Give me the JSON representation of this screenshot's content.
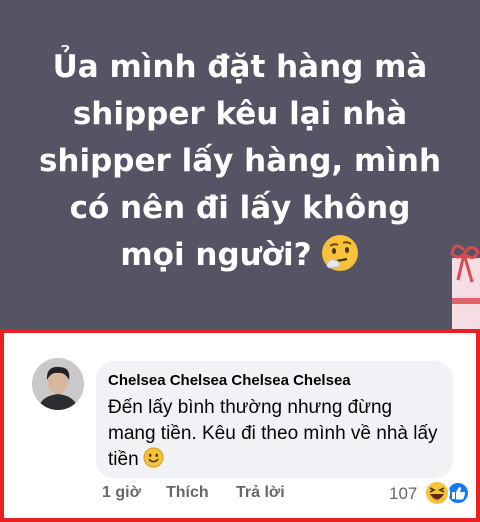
{
  "post": {
    "background": "#545465",
    "lines": [
      "Ủa mình đặt hàng mà",
      "shipper kêu lại nhà",
      "shipper lấy hàng, mình",
      "có nên đi lấy không",
      "mọi người?"
    ],
    "emoji": "thinking-face-icon"
  },
  "highlight_color": "#e8211f",
  "comment": {
    "author": "Chelsea Chelsea Chelsea Chelsea",
    "text": "Đến lấy bình thường nhưng đừng mang tiền. Kêu đi theo mình về nhà lấy tiền",
    "emoji": "smiling-face-icon",
    "actions": {
      "time": "1 giờ",
      "like": "Thích",
      "reply": "Trả lời"
    },
    "reaction_count": "107",
    "reaction_icons": [
      "haha-icon",
      "like-icon"
    ]
  }
}
